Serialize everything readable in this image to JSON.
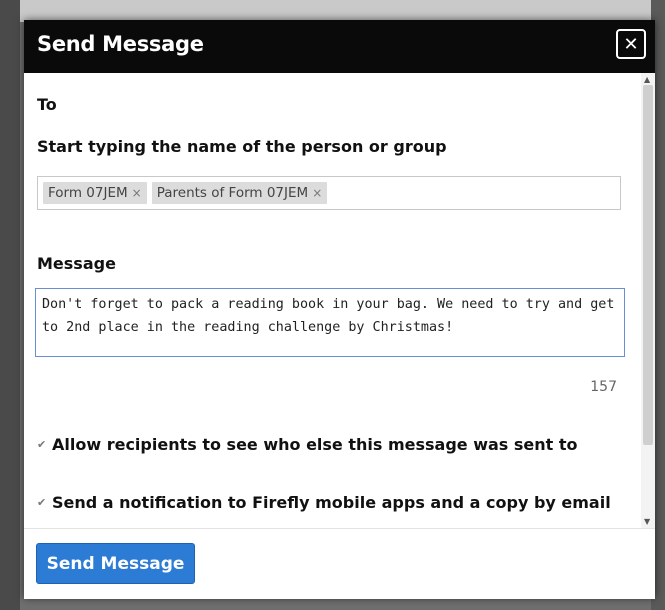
{
  "modal": {
    "title": "Send Message",
    "close_label": "✕"
  },
  "to_section": {
    "label": "To",
    "hint": "Start typing the name of the person or group",
    "recipients": [
      {
        "label": "Form 07JEM",
        "remove": "×"
      },
      {
        "label": "Parents of Form 07JEM",
        "remove": "×"
      }
    ]
  },
  "message_section": {
    "label": "Message",
    "value": "Don't forget to pack a reading book in your bag. We need to try and get to 2nd place in the reading challenge by Christmas!",
    "remaining_chars": "157"
  },
  "options": [
    {
      "label": "Allow recipients to see who else this message was sent to",
      "checked": true
    },
    {
      "label": "Send a notification to Firefly mobile apps and a copy by email",
      "checked": true
    }
  ],
  "footer": {
    "send_label": "Send Message"
  },
  "colors": {
    "header_bg": "#0a0a0a",
    "primary_button": "#2c7cd6",
    "focus_border": "#6a8fd0"
  }
}
